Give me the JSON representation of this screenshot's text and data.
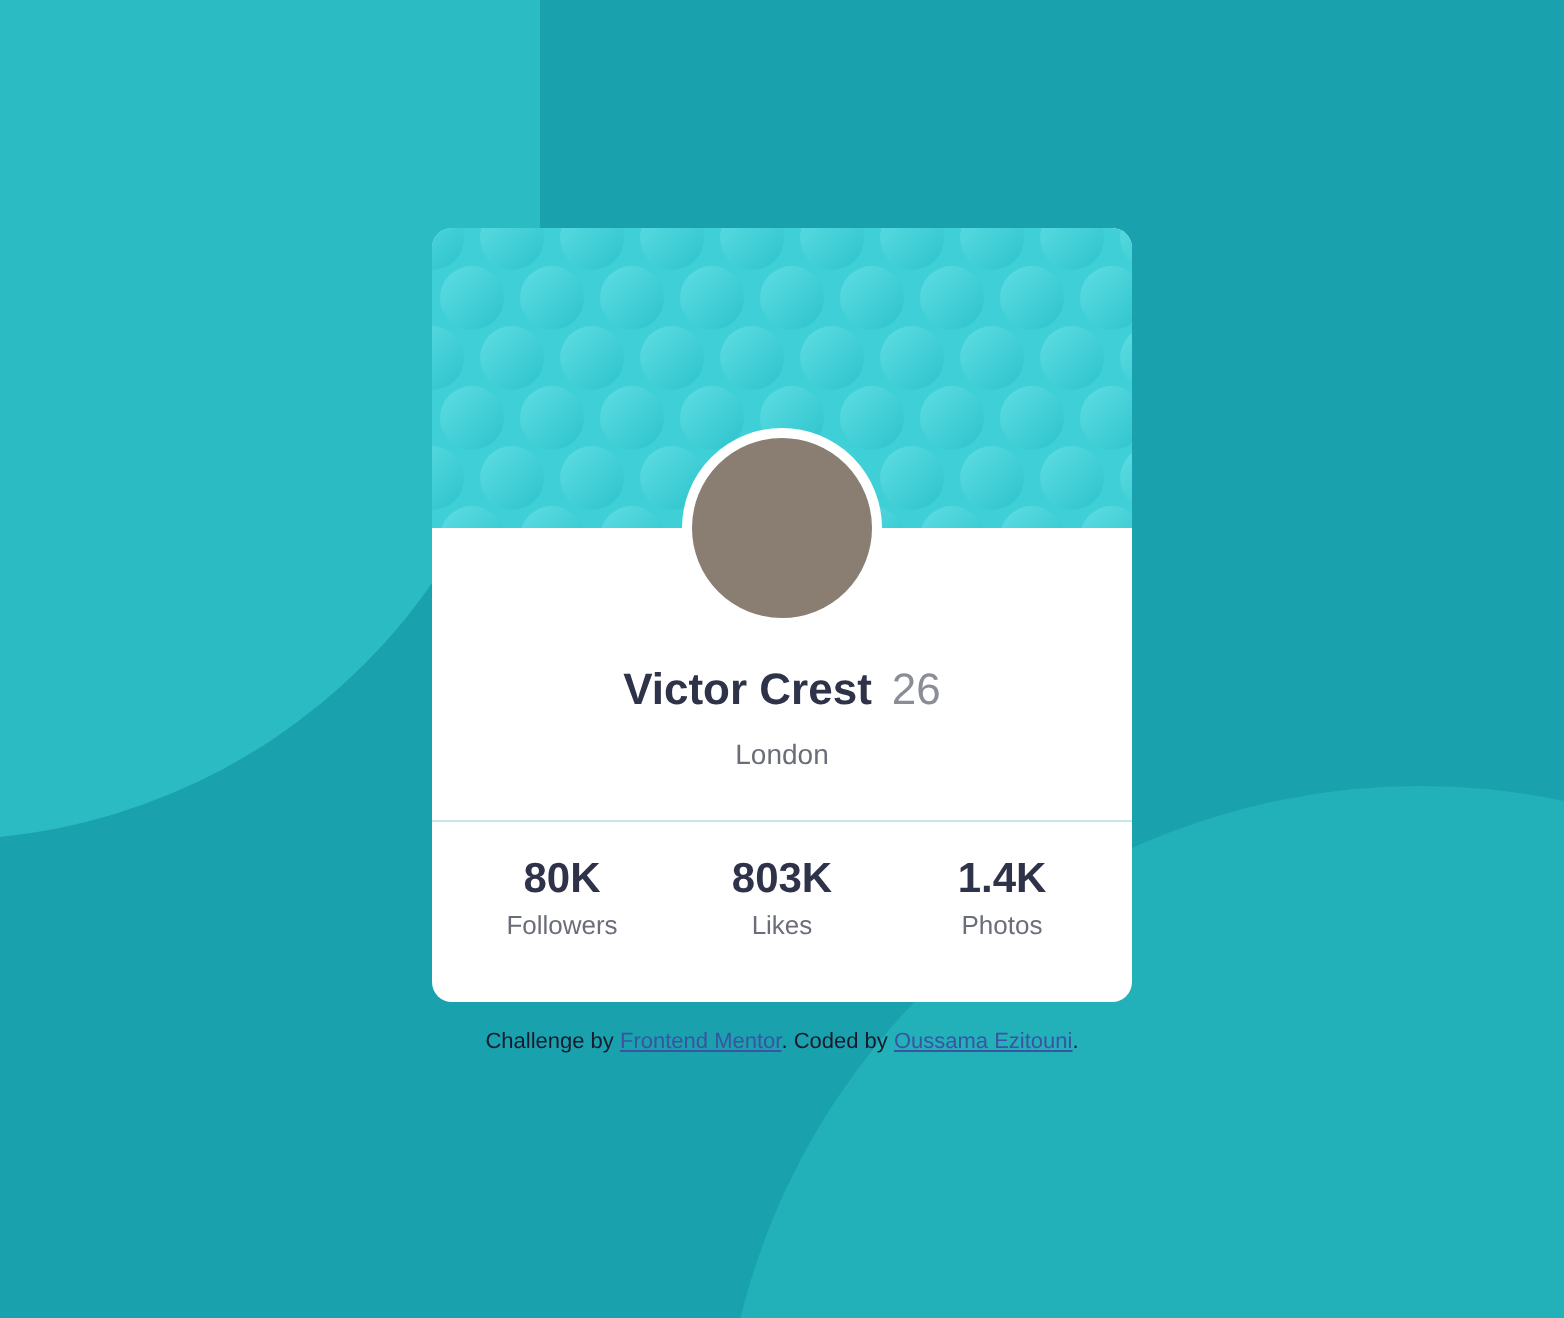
{
  "profile": {
    "name": "Victor Crest",
    "age": "26",
    "location": "London"
  },
  "stats": [
    {
      "value": "80K",
      "label": "Followers"
    },
    {
      "value": "803K",
      "label": "Likes"
    },
    {
      "value": "1.4K",
      "label": "Photos"
    }
  ],
  "attribution": {
    "prefix": "Challenge by ",
    "link_1": "Frontend Mentor",
    "middle": ". Coded by ",
    "link_2": "Oussama Ezitouni",
    "suffix": "."
  }
}
